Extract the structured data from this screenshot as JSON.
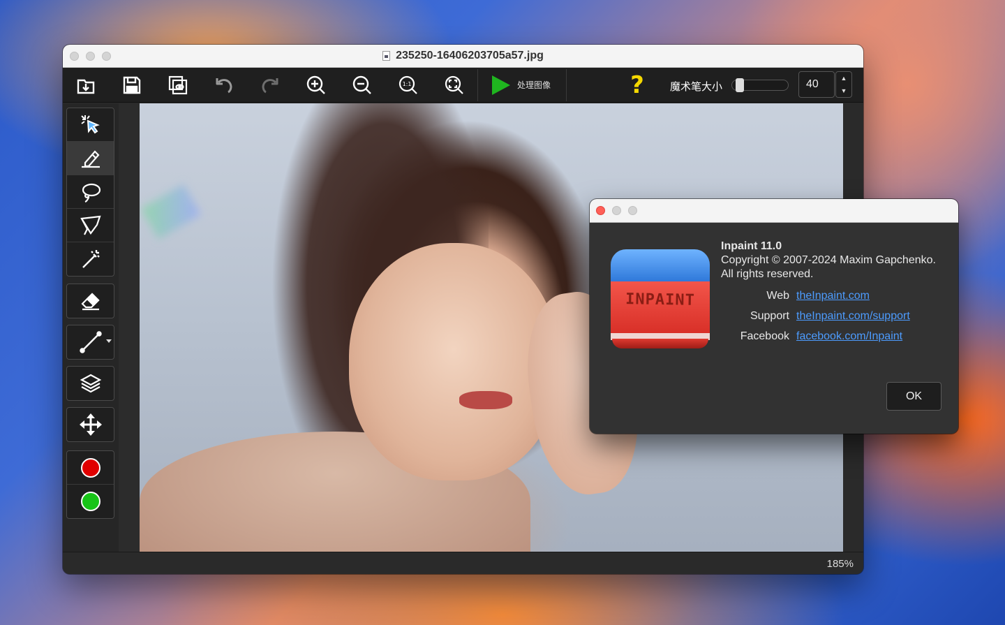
{
  "window": {
    "title": "235250-16406203705a57.jpg"
  },
  "toolbar": {
    "buttons": [
      {
        "name": "open-icon"
      },
      {
        "name": "save-icon"
      },
      {
        "name": "preview-icon"
      },
      {
        "name": "undo-icon"
      },
      {
        "name": "redo-icon"
      },
      {
        "name": "zoom-in-icon"
      },
      {
        "name": "zoom-out-icon"
      },
      {
        "name": "actual-size-icon"
      },
      {
        "name": "fit-window-icon"
      }
    ],
    "process_label": "处理图像",
    "help_label": "?",
    "brush_size_label": "魔术笔大小",
    "brush_size_value": "40",
    "brush_size_level": 0.05
  },
  "tools": [
    "select-icon",
    "marker-icon",
    "lasso-icon",
    "polygon-lasso-icon",
    "magic-wand-icon",
    "eraser-icon",
    "line-icon",
    "layers-icon",
    "move-icon"
  ],
  "colors": {
    "primary": "#e00000",
    "secondary": "#17c417",
    "accent_link": "#4d9cff",
    "play": "#1fb51f"
  },
  "status": {
    "zoom": "185%"
  },
  "about": {
    "app_name": "Inpaint 11.0",
    "copyright": "Copyright © 2007-2024 Maxim Gapchenko.",
    "rights": "All rights reserved.",
    "icon_text": "INPAINT",
    "links": [
      {
        "key": "Web",
        "value": "theInpaint.com"
      },
      {
        "key": "Support",
        "value": "theInpaint.com/support"
      },
      {
        "key": "Facebook",
        "value": "facebook.com/Inpaint"
      }
    ],
    "ok_label": "OK"
  }
}
